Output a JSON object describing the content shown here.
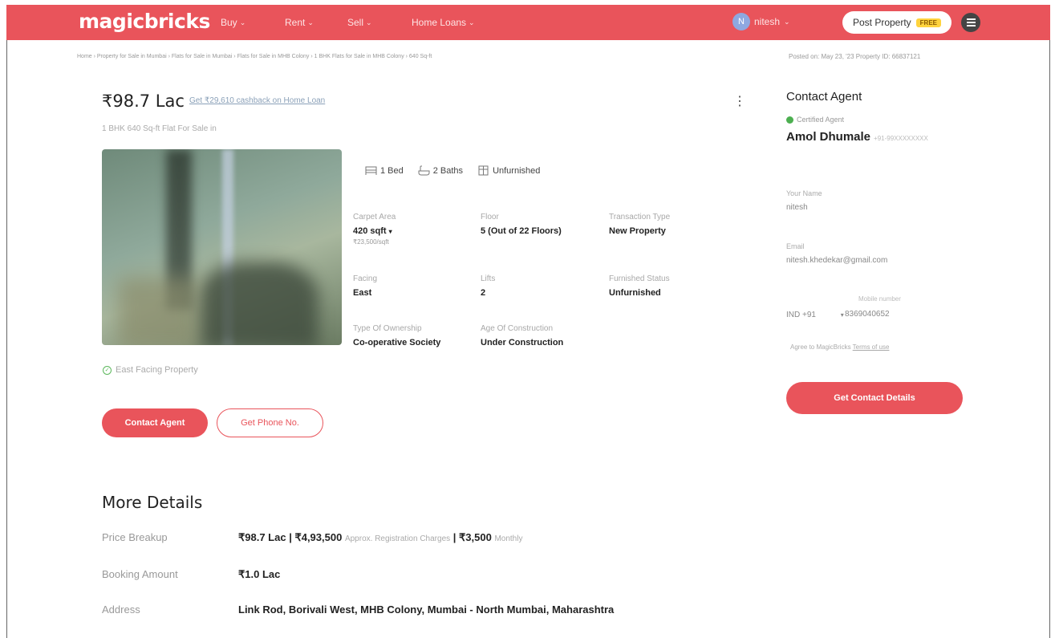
{
  "header": {
    "logo": "magicbricks",
    "nav": [
      {
        "label": "Buy"
      },
      {
        "label": "Rent"
      },
      {
        "label": "Sell"
      },
      {
        "label": "Home Loans"
      }
    ],
    "user": {
      "initial": "N",
      "name": "nitesh"
    },
    "post_property": "Post Property",
    "free_badge": "FREE",
    "brand_color": "#e9545b"
  },
  "breadcrumb": "Home › Property for Sale in Mumbai › Flats for Sale in Mumbai › Flats for Sale in MHB Colony › 1 BHK Flats for Sale in MHB Colony › 640 Sq-ft",
  "posted": "Posted on: May 23, '23    Property ID: 66837121",
  "listing": {
    "price": "₹98.7 Lac",
    "cashback": "Get ₹29,610 cashback on Home Loan",
    "subtitle": "1 BHK 640 Sq-ft Flat For Sale in",
    "facts": [
      {
        "icon": "bed-icon",
        "label": "1 Bed"
      },
      {
        "icon": "bath-icon",
        "label": "2 Baths"
      },
      {
        "icon": "wardrobe-icon",
        "label": "Unfurnished"
      }
    ],
    "specs": {
      "carpet_area": {
        "label": "Carpet Area",
        "value": "420 sqft",
        "sub": "₹23,500/sqft"
      },
      "floor": {
        "label": "Floor",
        "value": "5 (Out of 22 Floors)"
      },
      "transaction": {
        "label": "Transaction Type",
        "value": "New Property"
      },
      "facing": {
        "label": "Facing",
        "value": "East"
      },
      "lifts": {
        "label": "Lifts",
        "value": "2"
      },
      "furnished": {
        "label": "Furnished Status",
        "value": "Unfurnished"
      },
      "ownership": {
        "label": "Type Of Ownership",
        "value": "Co-operative Society"
      },
      "age": {
        "label": "Age Of Construction",
        "value": "Under Construction"
      }
    },
    "east_facing": "East Facing Property",
    "contact_agent": "Contact Agent",
    "get_phone": "Get Phone No."
  },
  "more_details": {
    "title": "More Details",
    "price_breakup": {
      "label": "Price Breakup",
      "price": "₹98.7 Lac | ₹4,93,500",
      "reg_note": "Approx. Registration Charges",
      "monthly": "| ₹3,500",
      "monthly_note": "Monthly"
    },
    "booking": {
      "label": "Booking Amount",
      "value": "₹1.0 Lac"
    },
    "address": {
      "label": "Address",
      "value": "Link Rod, Borivali West, MHB Colony, Mumbai - North Mumbai, Maharashtra"
    }
  },
  "contact_panel": {
    "title": "Contact Agent",
    "certified": "Certified Agent",
    "agent_name": "Amol Dhumale",
    "agent_phone": "+91-99XXXXXXXX",
    "name_label": "Your Name",
    "name_value": "nitesh",
    "email_label": "Email",
    "email_value": "nitesh.khedekar@gmail.com",
    "country_code": "IND +91",
    "mobile_label": "Mobile number",
    "mobile_value": "8369040652",
    "agree_text": "Agree to MagicBricks",
    "terms": "Terms of use",
    "get_contact": "Get Contact Details"
  }
}
